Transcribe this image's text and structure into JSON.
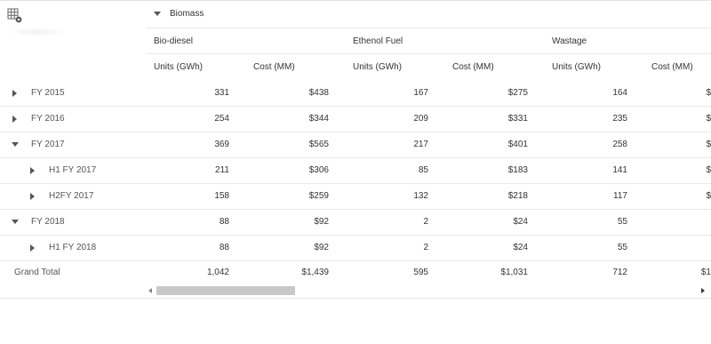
{
  "toolbar": {
    "settings_icon": "table-settings-icon"
  },
  "header": {
    "group": "Biomass",
    "subgroups": [
      "Bio-diesel",
      "Ethenol Fuel",
      "Wastage"
    ],
    "measures": [
      "Units (GWh)",
      "Cost (MM)",
      "Units (GWh)",
      "Cost (MM)",
      "Units (GWh)",
      "Cost (MM)"
    ]
  },
  "rows": [
    {
      "label": "FY 2015",
      "state": "collapsed",
      "values": [
        "331",
        "$438",
        "167",
        "$275",
        "164",
        "$"
      ]
    },
    {
      "label": "FY 2016",
      "state": "collapsed",
      "values": [
        "254",
        "$344",
        "209",
        "$331",
        "235",
        "$"
      ]
    },
    {
      "label": "FY 2017",
      "state": "expanded",
      "values": [
        "369",
        "$565",
        "217",
        "$401",
        "258",
        "$"
      ]
    },
    {
      "label": "H1 FY 2017",
      "state": "collapsed",
      "values": [
        "211",
        "$306",
        "85",
        "$183",
        "141",
        "$"
      ]
    },
    {
      "label": "H2FY 2017",
      "state": "collapsed",
      "values": [
        "158",
        "$259",
        "132",
        "$218",
        "117",
        "$"
      ]
    },
    {
      "label": "FY 2018",
      "state": "expanded",
      "values": [
        "88",
        "$92",
        "2",
        "$24",
        "55",
        ""
      ]
    },
    {
      "label": "H1 FY 2018",
      "state": "collapsed",
      "values": [
        "88",
        "$92",
        "2",
        "$24",
        "55",
        ""
      ]
    }
  ],
  "grand_total": {
    "label": "Grand Total",
    "values": [
      "1,042",
      "$1,439",
      "595",
      "$1,031",
      "712",
      "$1"
    ]
  },
  "colors": {
    "line": "#e8e8e8",
    "text": "#333333",
    "scroll_thumb": "#c8c8c8"
  }
}
